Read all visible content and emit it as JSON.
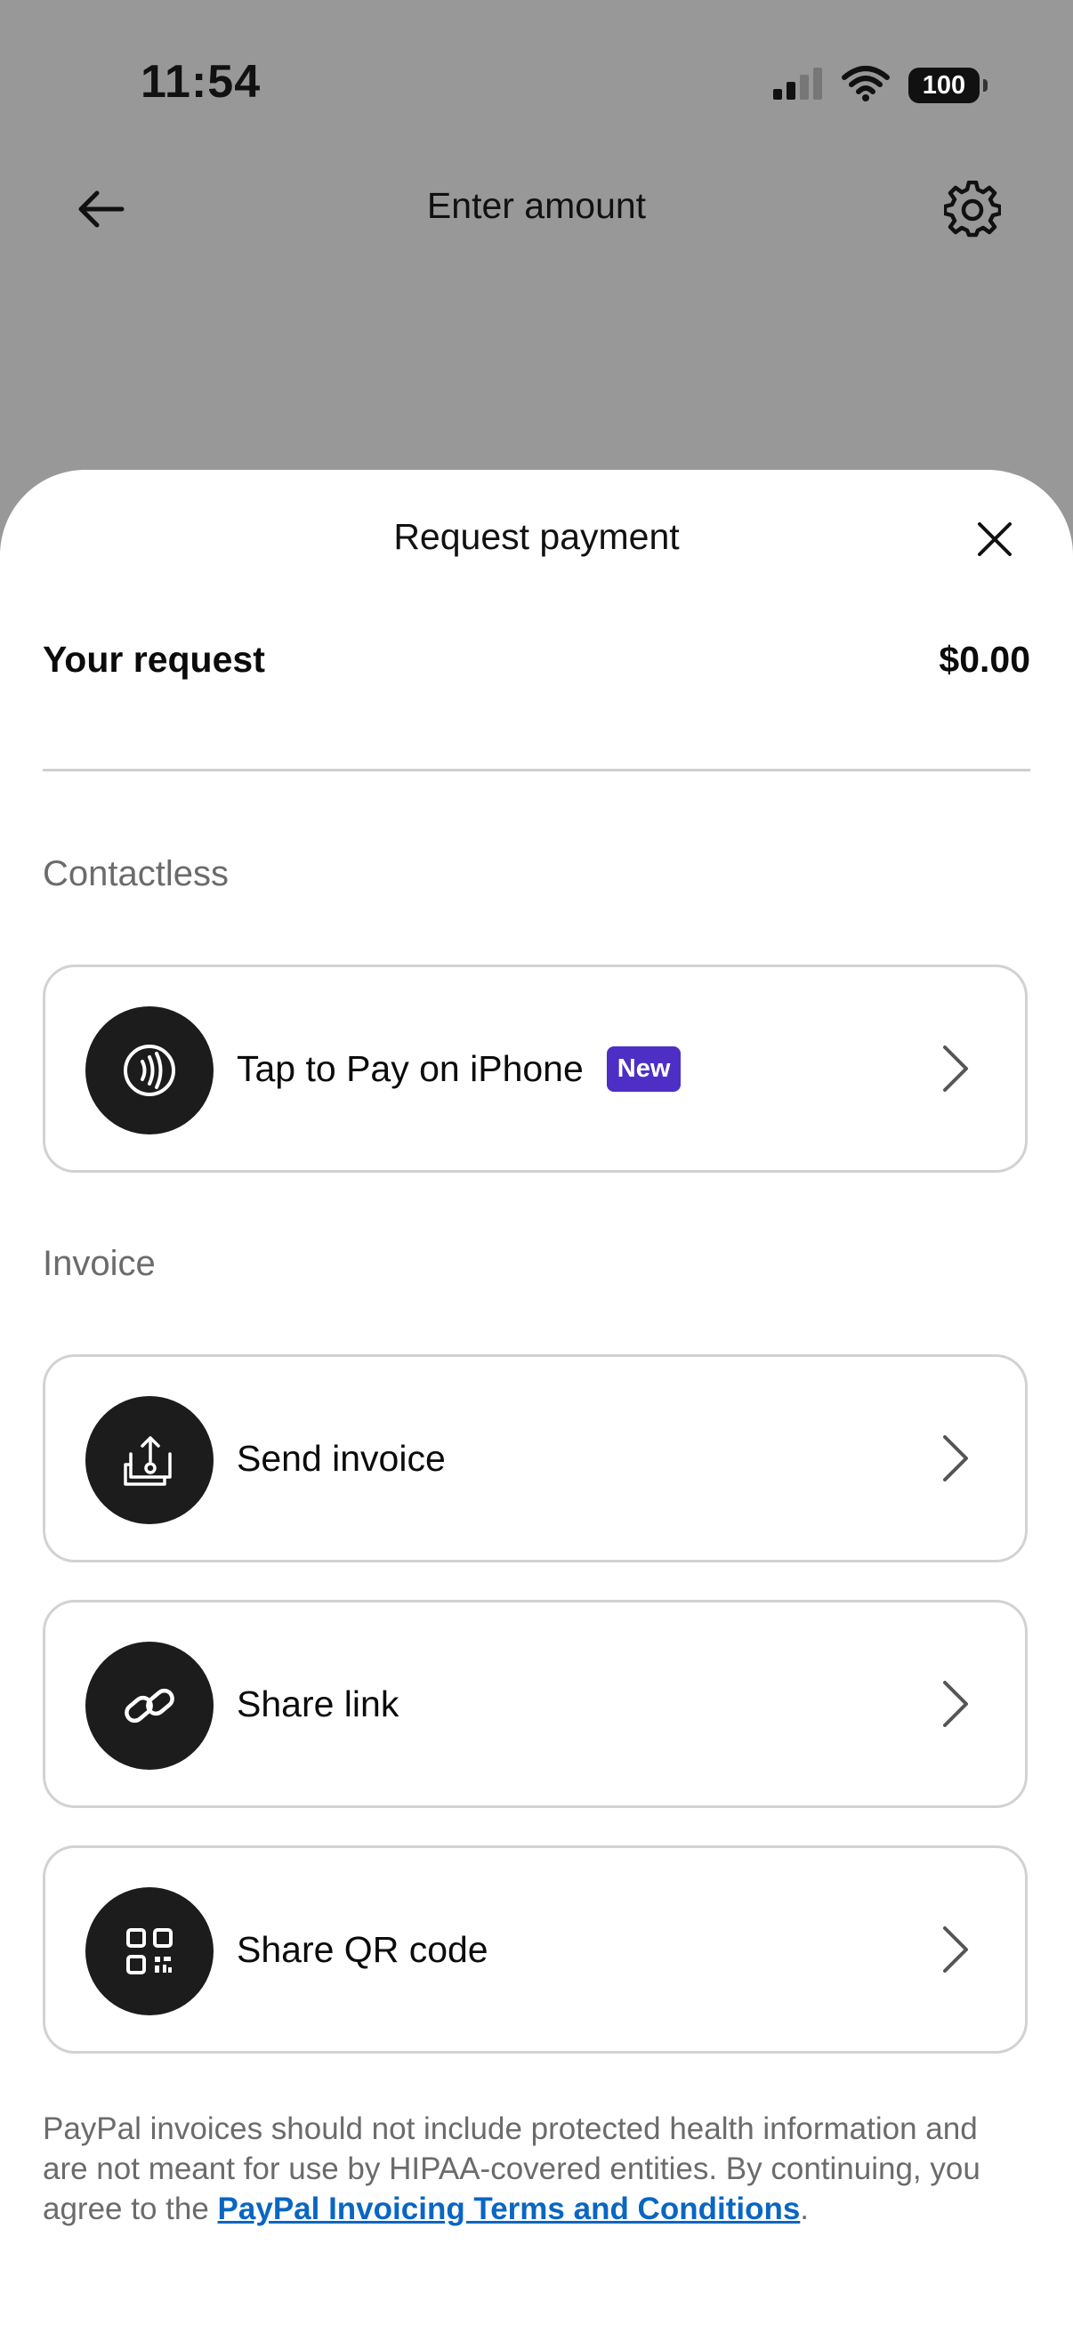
{
  "status_bar": {
    "time": "11:54",
    "battery": "100"
  },
  "nav": {
    "title": "Enter amount"
  },
  "sheet": {
    "title": "Request payment",
    "request_label": "Your request",
    "request_amount": "$0.00",
    "sections": {
      "contactless": "Contactless",
      "invoice": "Invoice"
    },
    "options": [
      {
        "label": "Tap to Pay on iPhone",
        "badge": "New",
        "icon": "contactless-icon"
      },
      {
        "label": "Send invoice",
        "icon": "send-invoice-icon"
      },
      {
        "label": "Share link",
        "icon": "link-icon"
      },
      {
        "label": "Share QR code",
        "icon": "qr-code-icon"
      }
    ],
    "disclaimer": {
      "text": "PayPal invoices should not include protected health information and are not meant for use by HIPAA-covered entities. By continuing, you agree to the ",
      "link": "PayPal Invoicing Terms and Conditions",
      "end": "."
    }
  },
  "colors": {
    "backdrop": "#989898",
    "badge": "#4d2fc6",
    "link": "#0a66c2",
    "icon_circle": "#1c1c1c"
  }
}
